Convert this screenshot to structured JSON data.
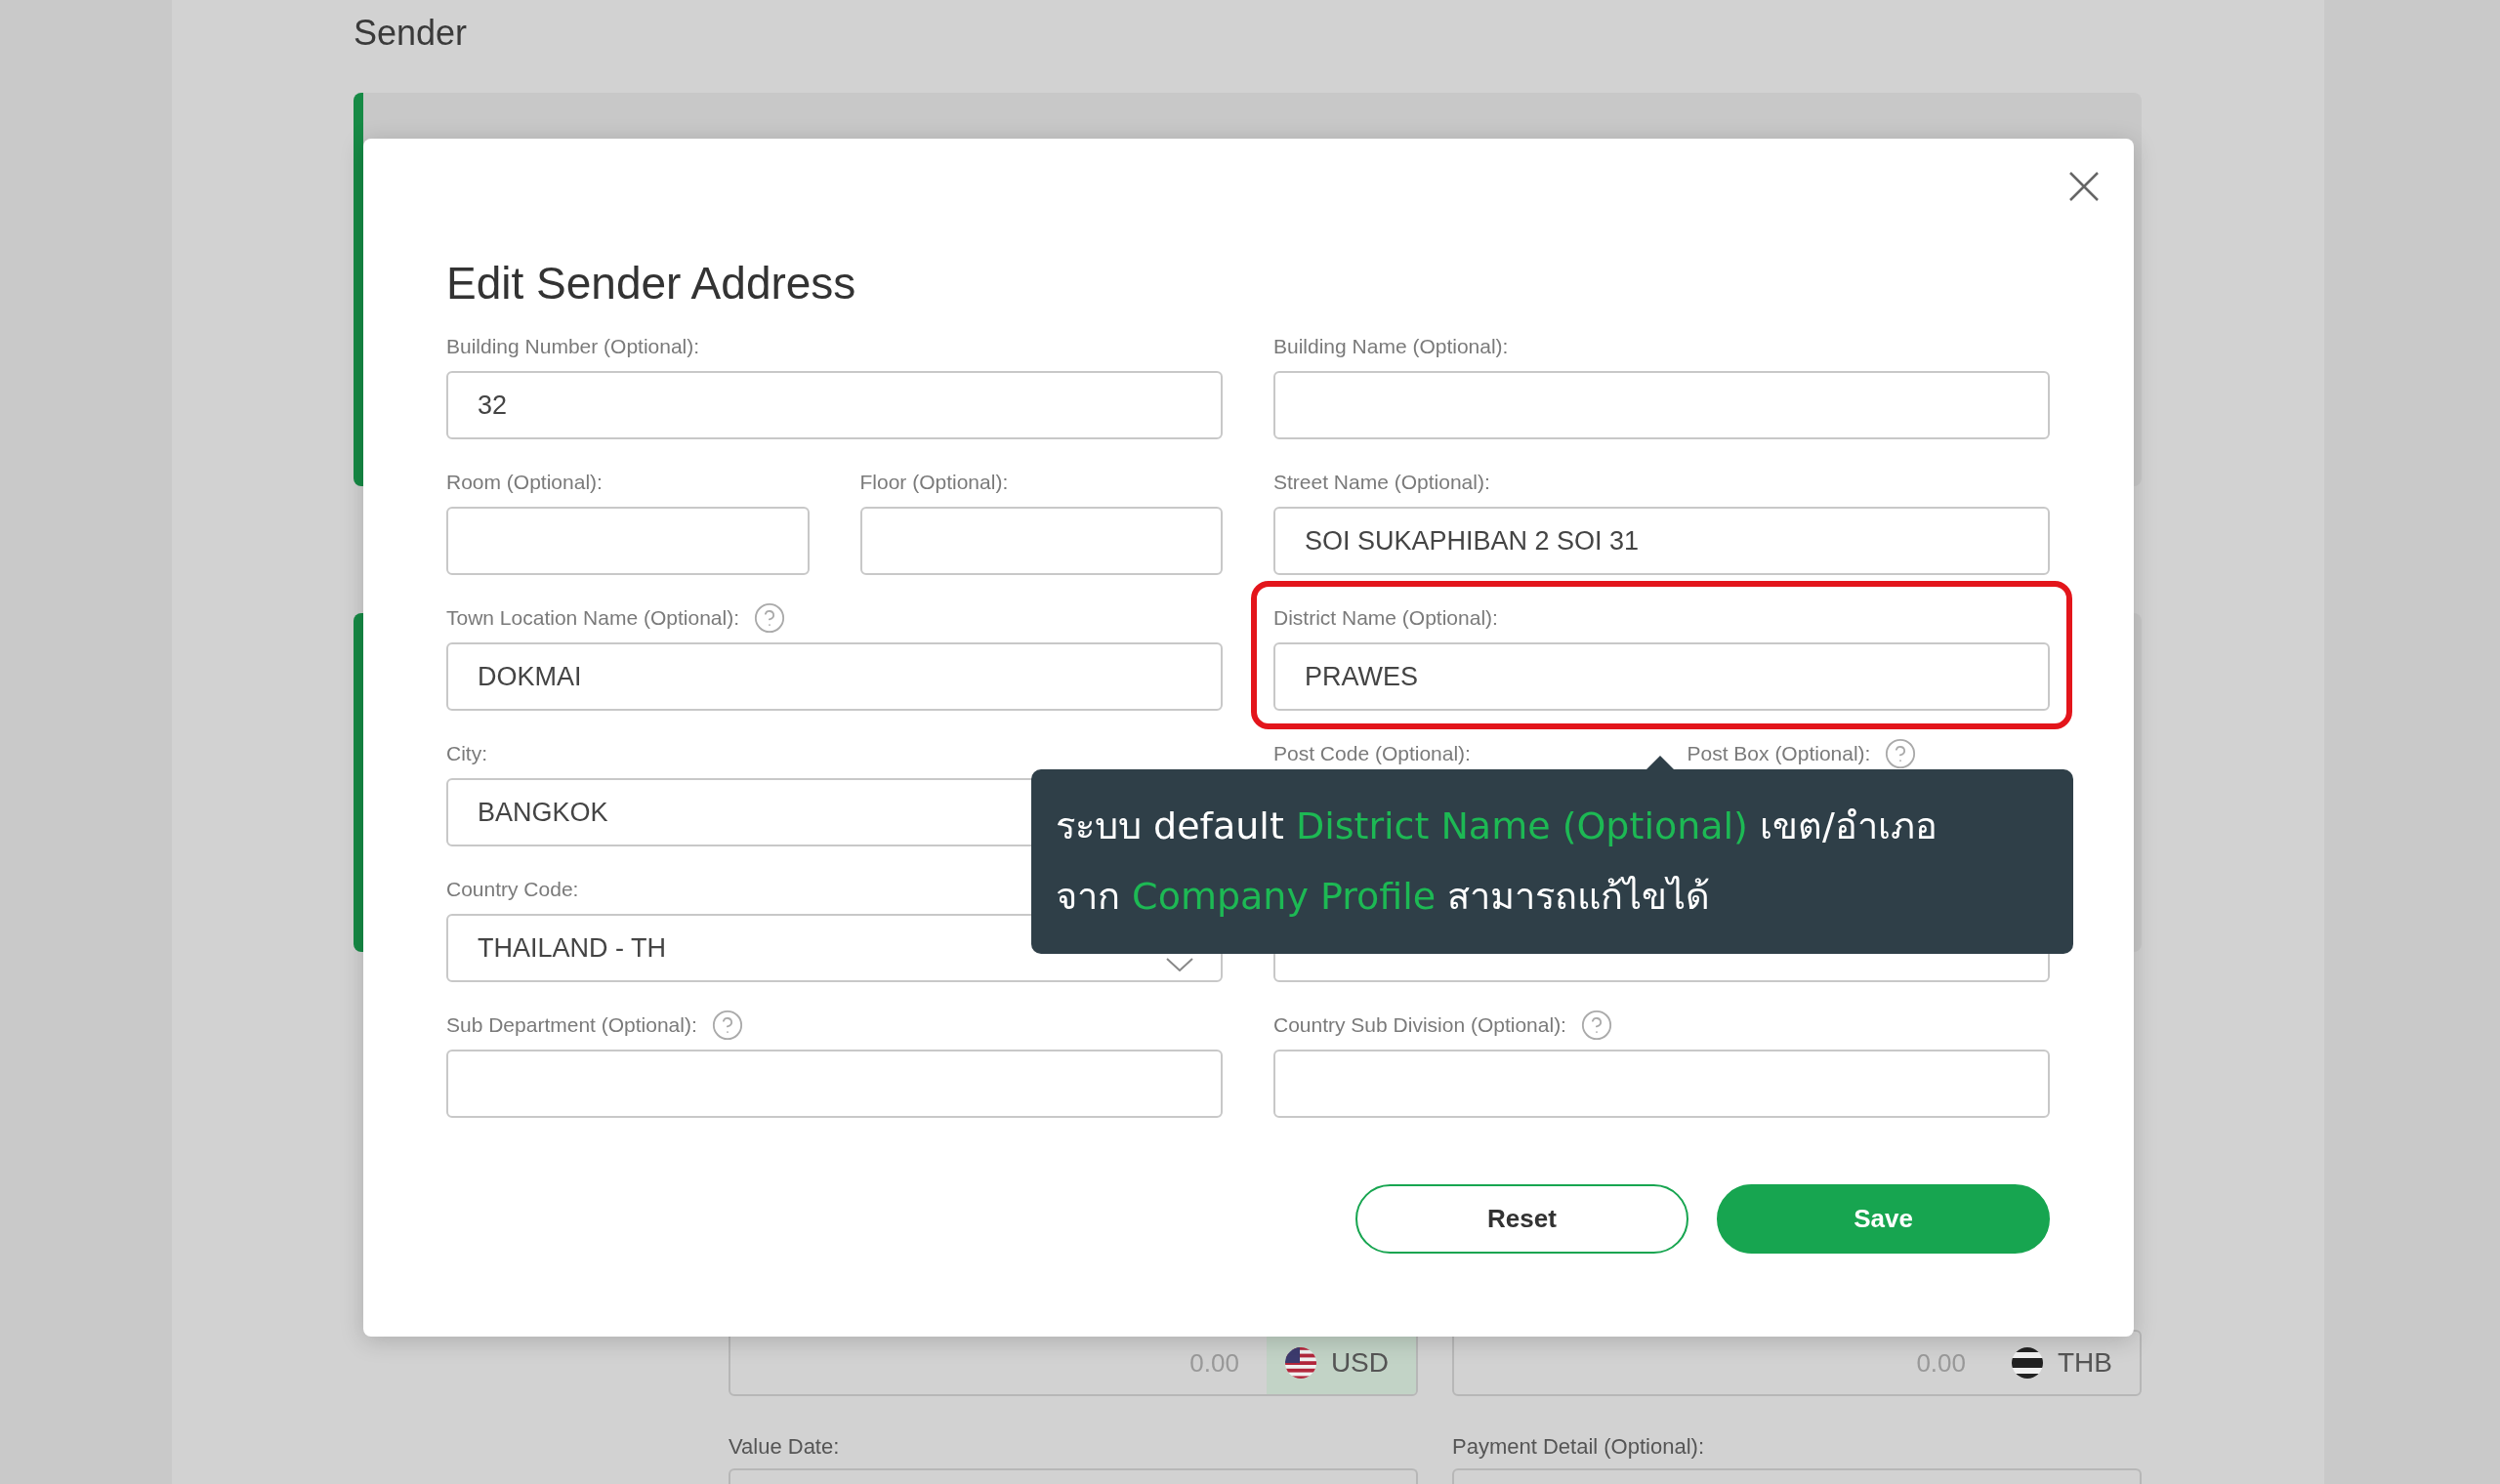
{
  "background": {
    "section_title": "Sender",
    "amounts": [
      {
        "placeholder": "0.00",
        "currency": "USD",
        "highlighted": true
      },
      {
        "placeholder": "0.00",
        "currency": "THB",
        "highlighted": false
      }
    ],
    "labels": [
      "Value Date:",
      "Payment Detail (Optional):"
    ]
  },
  "dialog": {
    "title": "Edit Sender Address",
    "rows": [
      {
        "left": [
          {
            "kind": "text",
            "label": "Building Number (Optional):",
            "value": "32",
            "help": false,
            "highlighted": false
          }
        ],
        "right": [
          {
            "kind": "text",
            "label": "Building Name (Optional):",
            "help": false,
            "highlighted": false
          }
        ]
      },
      {
        "left": [
          {
            "kind": "text",
            "label": "Room (Optional):",
            "help": false,
            "highlighted": false
          },
          {
            "kind": "text",
            "label": "Floor (Optional):",
            "help": false,
            "highlighted": false
          }
        ],
        "right": [
          {
            "kind": "text",
            "label": "Street Name (Optional):",
            "value": "SOI SUKAPHIBAN 2 SOI 31",
            "help": false,
            "highlighted": false
          }
        ]
      },
      {
        "left": [
          {
            "kind": "text",
            "label": "Town Location Name (Optional):",
            "value": "DOKMAI",
            "help": true,
            "highlighted": false
          }
        ],
        "right": [
          {
            "kind": "text",
            "label": "District Name (Optional):",
            "value": "PRAWES",
            "help": false,
            "highlighted": true
          }
        ]
      },
      {
        "left": [
          {
            "kind": "text",
            "label": "City:",
            "value": "BANGKOK",
            "help": false,
            "highlighted": false
          }
        ],
        "right": [
          {
            "kind": "covered",
            "label": "Post Code (Optional):",
            "help": false,
            "highlighted": false
          },
          {
            "kind": "covered",
            "label": "Post Box (Optional):",
            "help": true,
            "highlighted": false
          }
        ]
      },
      {
        "left": [
          {
            "kind": "select",
            "label": "Country Code:",
            "value": "THAILAND - TH",
            "help": false,
            "highlighted": false
          }
        ],
        "right": [
          {
            "kind": "text",
            "help": false,
            "highlighted": false
          }
        ]
      },
      {
        "left": [
          {
            "kind": "text",
            "label": "Sub Department (Optional):",
            "help": true,
            "highlighted": false
          }
        ],
        "right": [
          {
            "kind": "text",
            "label": "Country Sub Division (Optional):",
            "help": true,
            "highlighted": false
          }
        ]
      }
    ],
    "buttons": [
      {
        "label": "Reset",
        "kind": "secondary"
      },
      {
        "label": "Save",
        "kind": "primary"
      }
    ],
    "tooltip": {
      "lines": [
        [
          {
            "text": "ระบบ default ",
            "accent": false
          },
          {
            "text": "District Name (Optional)",
            "accent": true
          },
          {
            "text": " เขต/อำเภอ",
            "accent": false
          }
        ],
        [
          {
            "text": "จาก ",
            "accent": false
          },
          {
            "text": "Company Profile",
            "accent": true
          },
          {
            "text": " สามารถแก้ไขได้",
            "accent": false
          }
        ]
      ]
    }
  }
}
